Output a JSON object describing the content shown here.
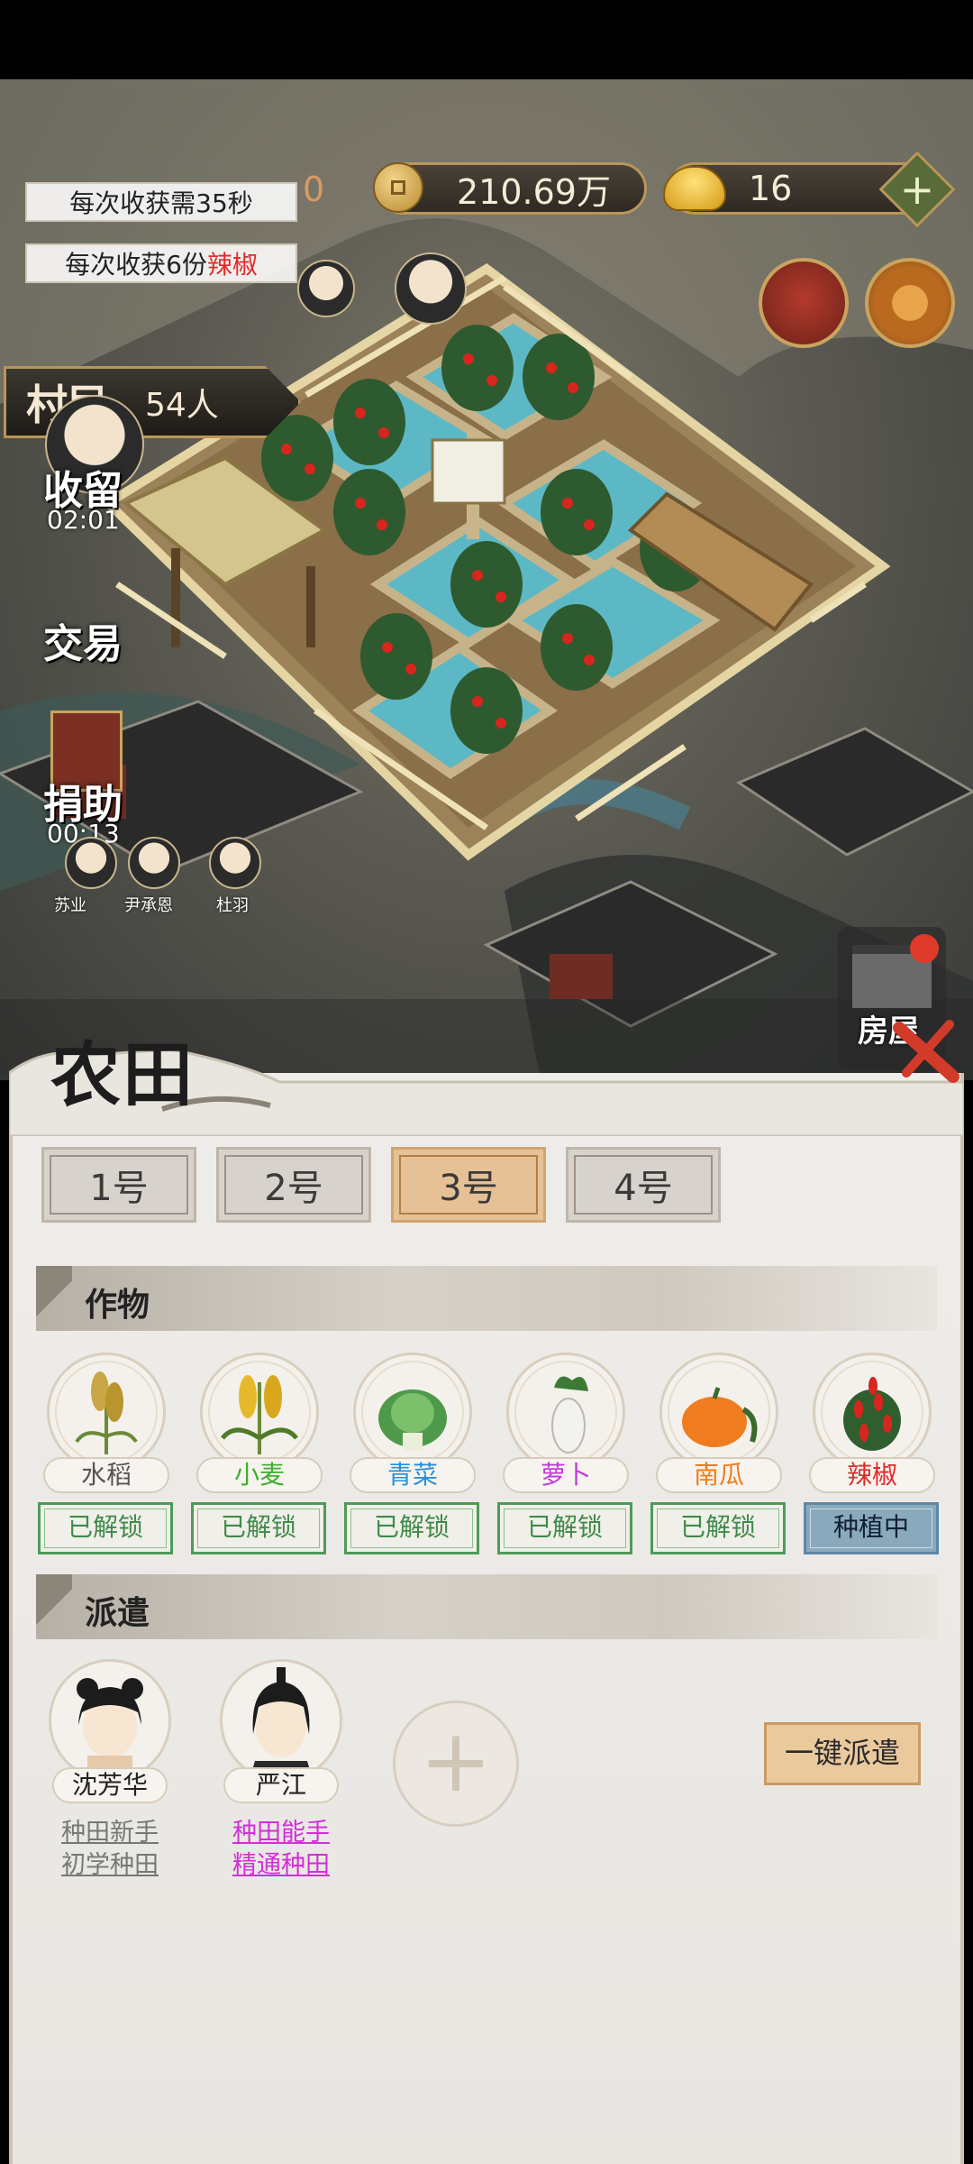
{
  "hud": {
    "copper": "210.69万",
    "gold": "16",
    "partial_digit": "0",
    "harvest_time": "每次收获需35秒",
    "harvest_yield_prefix": "每次收获6份",
    "harvest_yield_crop": "辣椒",
    "villager_label": "村民",
    "villager_count": "54人"
  },
  "side": {
    "shelter": "收留",
    "shelter_timer": "02:01",
    "trade": "交易",
    "donate": "捐助",
    "donate_timer": "00:13",
    "house": "房屋",
    "mini_names": [
      "苏业",
      "尹承恩",
      "杜羽"
    ]
  },
  "panel": {
    "title": "农田",
    "tabs": [
      "1号",
      "2号",
      "3号",
      "4号"
    ],
    "active_tab": "3号",
    "crops_title": "作物",
    "crops": [
      {
        "name": "水稻",
        "status": "已解锁",
        "color": "#555555"
      },
      {
        "name": "小麦",
        "status": "已解锁",
        "color": "#3fae2e"
      },
      {
        "name": "青菜",
        "status": "已解锁",
        "color": "#2a8fd8"
      },
      {
        "name": "萝卜",
        "status": "已解锁",
        "color": "#c23ad8"
      },
      {
        "name": "南瓜",
        "status": "已解锁",
        "color": "#f07d1a"
      },
      {
        "name": "辣椒",
        "status": "种植中",
        "color": "#e02a2a"
      }
    ],
    "dispatch_title": "派遣",
    "workers": [
      {
        "name": "沈芳华",
        "tag1": "种田新手",
        "tag2": "初学种田",
        "color": "#777777"
      },
      {
        "name": "严江",
        "tag1": "种田能手",
        "tag2": "精通种田",
        "color": "#d12fd6"
      }
    ],
    "add_symbol": "+",
    "dispatch_button": "一键派遣"
  }
}
